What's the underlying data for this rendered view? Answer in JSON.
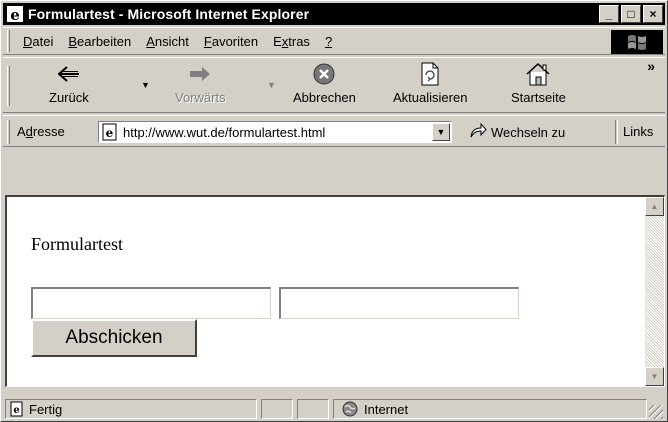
{
  "window": {
    "title": "Formulartest - Microsoft Internet Explorer",
    "minimize_glyph": "_",
    "maximize_glyph": "□",
    "close_glyph": "×"
  },
  "menu": {
    "items": [
      {
        "pre": "",
        "key": "D",
        "post": "atei"
      },
      {
        "pre": "",
        "key": "B",
        "post": "earbeiten"
      },
      {
        "pre": "",
        "key": "A",
        "post": "nsicht"
      },
      {
        "pre": "",
        "key": "F",
        "post": "avoriten"
      },
      {
        "pre": "E",
        "key": "x",
        "post": "tras"
      },
      {
        "pre": "",
        "key": "?",
        "post": ""
      }
    ]
  },
  "toolbar": {
    "back_label": "Zurück",
    "forward_label": "Vorwärts",
    "stop_label": "Abbrechen",
    "refresh_label": "Aktualisieren",
    "home_label": "Startseite",
    "more_glyph": "»"
  },
  "addressbar": {
    "label_pre": "A",
    "label_key": "d",
    "label_post": "resse",
    "url": "http://www.wut.de/formulartest.html",
    "go_label": "Wechseln zu",
    "links_label": "Links"
  },
  "page": {
    "heading": "Formulartest",
    "field1_value": "",
    "field2_value": "",
    "submit_label": "Abschicken"
  },
  "status": {
    "text": "Fertig",
    "zone": "Internet"
  }
}
